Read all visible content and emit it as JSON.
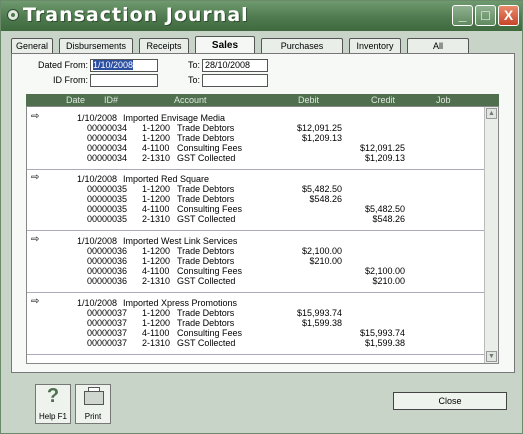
{
  "window": {
    "title": "Transaction Journal",
    "buttons": {
      "minimize": "_",
      "maximize": "□",
      "close": "X"
    }
  },
  "tabs": [
    {
      "label": "General"
    },
    {
      "label": "Disbursements"
    },
    {
      "label": "Receipts"
    },
    {
      "label": "Sales",
      "active": true
    },
    {
      "label": "Purchases"
    },
    {
      "label": "Inventory"
    },
    {
      "label": "All"
    }
  ],
  "filters": {
    "dated_from_label": "Dated From:",
    "dated_from_value": "1/10/2008",
    "to_label_1": "To:",
    "to_value_1": "28/10/2008",
    "id_from_label": "ID From:",
    "id_from_value": "",
    "to_label_2": "To:",
    "to_value_2": ""
  },
  "grid": {
    "columns": {
      "date": "Date",
      "id": "ID#",
      "account": "Account",
      "debit": "Debit",
      "credit": "Credit",
      "job": "Job"
    },
    "groups": [
      {
        "date": "1/10/2008",
        "memo": "Imported Envisage Media",
        "lines": [
          {
            "id": "00000034",
            "acct": "1-1200",
            "name": "Trade Debtors",
            "debit": "$12,091.25",
            "credit": ""
          },
          {
            "id": "00000034",
            "acct": "1-1200",
            "name": "Trade Debtors",
            "debit": "$1,209.13",
            "credit": ""
          },
          {
            "id": "00000034",
            "acct": "4-1100",
            "name": "Consulting Fees",
            "debit": "",
            "credit": "$12,091.25"
          },
          {
            "id": "00000034",
            "acct": "2-1310",
            "name": "GST Collected",
            "debit": "",
            "credit": "$1,209.13"
          }
        ]
      },
      {
        "date": "1/10/2008",
        "memo": "Imported Red Square",
        "lines": [
          {
            "id": "00000035",
            "acct": "1-1200",
            "name": "Trade Debtors",
            "debit": "$5,482.50",
            "credit": ""
          },
          {
            "id": "00000035",
            "acct": "1-1200",
            "name": "Trade Debtors",
            "debit": "$548.26",
            "credit": ""
          },
          {
            "id": "00000035",
            "acct": "4-1100",
            "name": "Consulting Fees",
            "debit": "",
            "credit": "$5,482.50"
          },
          {
            "id": "00000035",
            "acct": "2-1310",
            "name": "GST Collected",
            "debit": "",
            "credit": "$548.26"
          }
        ]
      },
      {
        "date": "1/10/2008",
        "memo": "Imported West Link Services",
        "lines": [
          {
            "id": "00000036",
            "acct": "1-1200",
            "name": "Trade Debtors",
            "debit": "$2,100.00",
            "credit": ""
          },
          {
            "id": "00000036",
            "acct": "1-1200",
            "name": "Trade Debtors",
            "debit": "$210.00",
            "credit": ""
          },
          {
            "id": "00000036",
            "acct": "4-1100",
            "name": "Consulting Fees",
            "debit": "",
            "credit": "$2,100.00"
          },
          {
            "id": "00000036",
            "acct": "2-1310",
            "name": "GST Collected",
            "debit": "",
            "credit": "$210.00"
          }
        ]
      },
      {
        "date": "1/10/2008",
        "memo": "Imported Xpress Promotions",
        "lines": [
          {
            "id": "00000037",
            "acct": "1-1200",
            "name": "Trade Debtors",
            "debit": "$15,993.74",
            "credit": ""
          },
          {
            "id": "00000037",
            "acct": "1-1200",
            "name": "Trade Debtors",
            "debit": "$1,599.38",
            "credit": ""
          },
          {
            "id": "00000037",
            "acct": "4-1100",
            "name": "Consulting Fees",
            "debit": "",
            "credit": "$15,993.74"
          },
          {
            "id": "00000037",
            "acct": "2-1310",
            "name": "GST Collected",
            "debit": "",
            "credit": "$1,599.38"
          }
        ]
      }
    ]
  },
  "buttons": {
    "help_label": "Help F1",
    "help_glyph": "?",
    "print_label": "Print",
    "close_label": "Close"
  },
  "icons": {
    "group_arrow": "arrow-right-icon",
    "help": "help-icon",
    "print": "printer-icon"
  }
}
